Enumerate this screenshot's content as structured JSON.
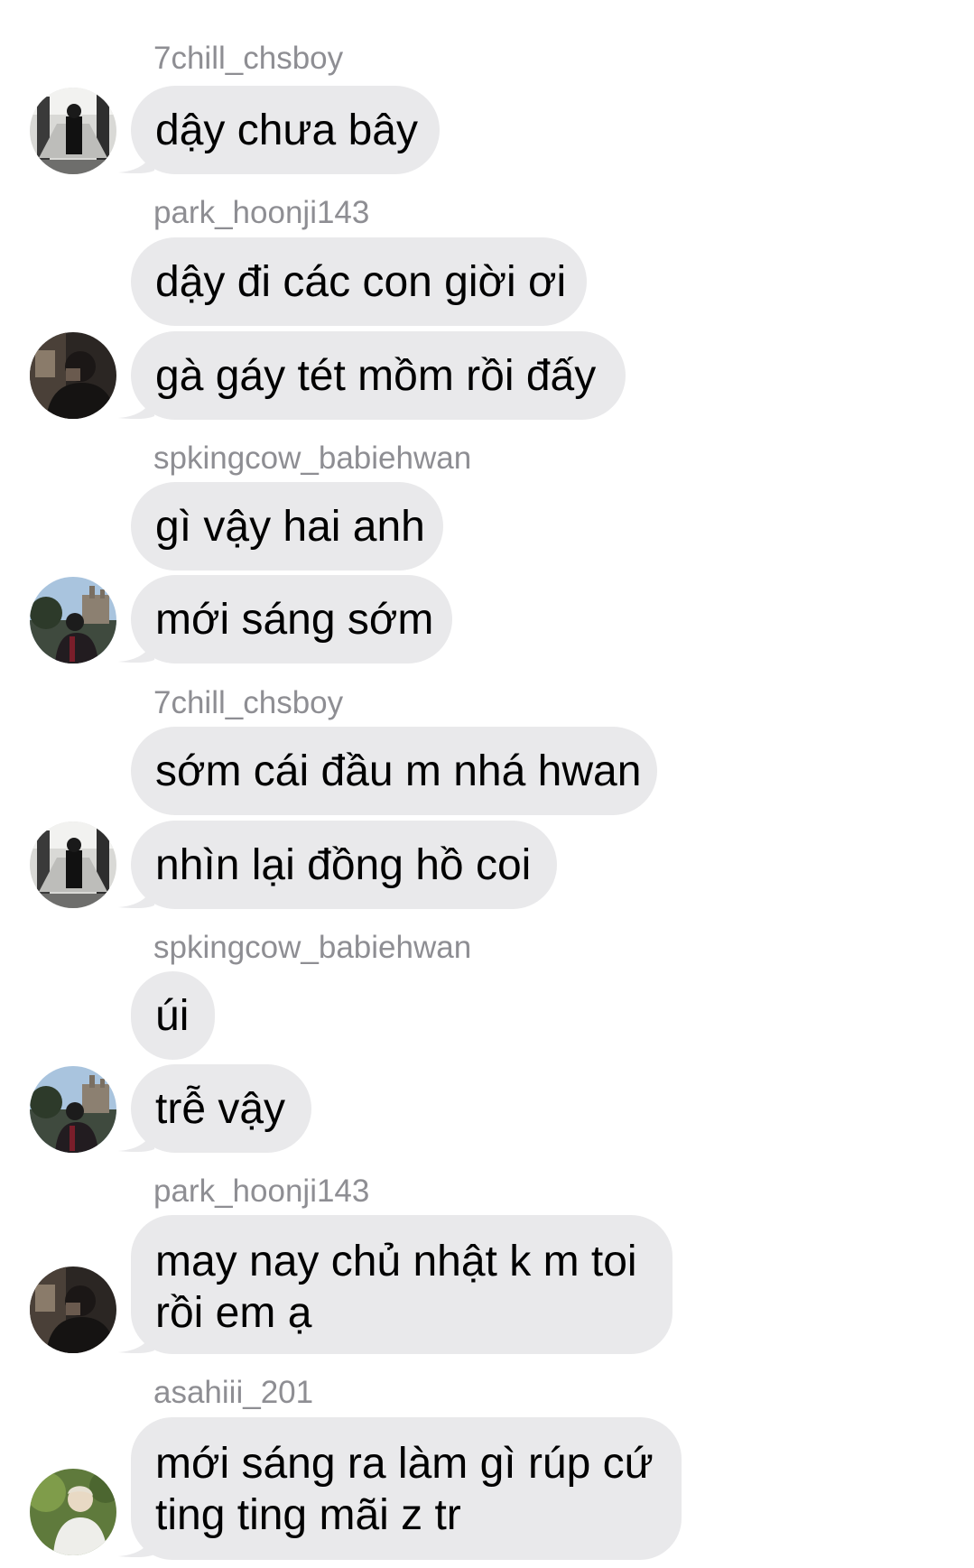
{
  "chat": {
    "groups": [
      {
        "sender": "7chill_chsboy",
        "avatar_icon": "avatar-7chill-chsboy",
        "messages": [
          "dậy chưa bây"
        ]
      },
      {
        "sender": "park_hoonji143",
        "avatar_icon": "avatar-park-hoonji143",
        "messages": [
          "dậy đi các con giời ơi",
          "gà gáy tét mồm rồi đấy"
        ]
      },
      {
        "sender": "spkingcow_babiehwan",
        "avatar_icon": "avatar-spkingcow-babiehwan",
        "messages": [
          "gì vậy hai anh",
          "mới sáng sớm"
        ]
      },
      {
        "sender": "7chill_chsboy",
        "avatar_icon": "avatar-7chill-chsboy",
        "messages": [
          "sớm cái đầu m nhá hwan",
          "nhìn lại đồng hồ coi"
        ]
      },
      {
        "sender": "spkingcow_babiehwan",
        "avatar_icon": "avatar-spkingcow-babiehwan",
        "messages": [
          "úi",
          "trễ vậy"
        ]
      },
      {
        "sender": "park_hoonji143",
        "avatar_icon": "avatar-park-hoonji143",
        "messages": [
          [
            "may nay chủ nhật k m toi",
            "rồi em ạ"
          ]
        ]
      },
      {
        "sender": "asahiii_201",
        "avatar_icon": "avatar-asahiii-201",
        "messages": [
          [
            "mới sáng ra làm gì rúp cứ",
            "ting ting mãi z tr"
          ]
        ]
      }
    ]
  },
  "colors": {
    "bubble": "#e9e9eb",
    "sender_name": "#8e8e93",
    "message_text": "#000000",
    "background": "#ffffff"
  }
}
